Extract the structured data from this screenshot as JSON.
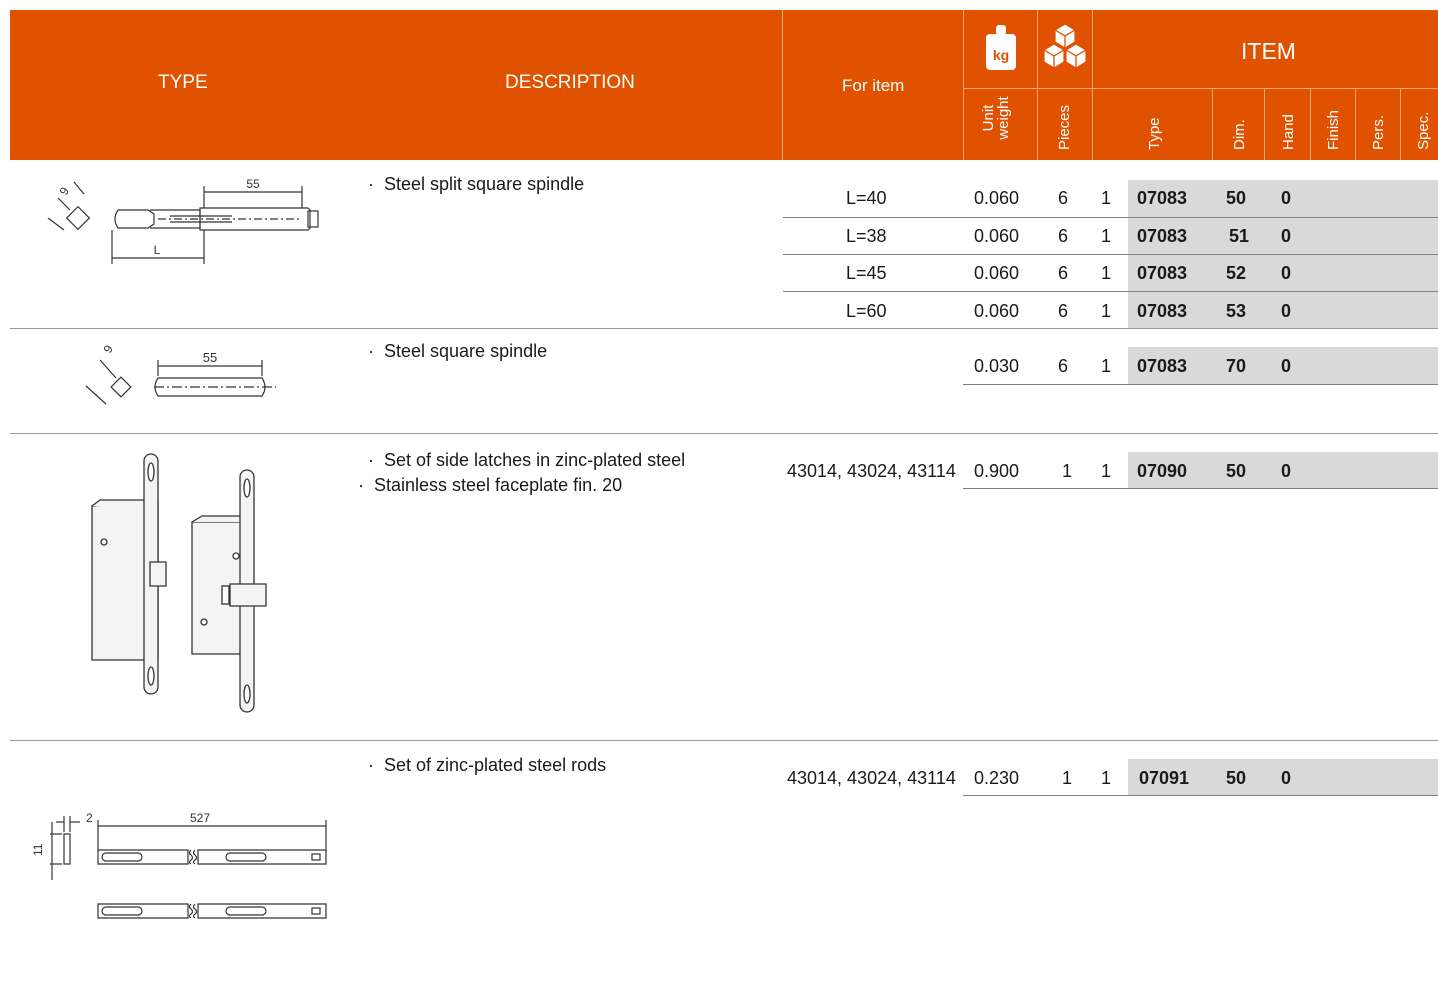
{
  "header": {
    "type_label": "TYPE",
    "description_label": "DESCRIPTION",
    "for_item_label": "For item",
    "weight_icon_text": "kg",
    "item_label": "ITEM",
    "unit_weight_line1": "Unit",
    "unit_weight_line2": "weight",
    "pieces_label": "Pieces",
    "type_col_label": "Type",
    "dim_label": "Dim.",
    "hand_label": "Hand",
    "finish_label": "Finish",
    "pers_label": "Pers.",
    "spec_label": "Spec."
  },
  "sections": [
    {
      "description": [
        "Steel split square spindle"
      ],
      "drawing_labels": {
        "dim_top": "55",
        "dim_bottom": "L",
        "dim_square": "9"
      },
      "rows": [
        {
          "for_item": "L=40",
          "weight": "0.060",
          "pieces": "6",
          "qty": "1",
          "type": "07083",
          "dim": "50",
          "hand": "0"
        },
        {
          "for_item": "L=38",
          "weight": "0.060",
          "pieces": "6",
          "qty": "1",
          "type": "07083",
          "dim": "51",
          "hand": "0"
        },
        {
          "for_item": "L=45",
          "weight": "0.060",
          "pieces": "6",
          "qty": "1",
          "type": "07083",
          "dim": "52",
          "hand": "0"
        },
        {
          "for_item": "L=60",
          "weight": "0.060",
          "pieces": "6",
          "qty": "1",
          "type": "07083",
          "dim": "53",
          "hand": "0"
        }
      ]
    },
    {
      "description": [
        "Steel square spindle"
      ],
      "drawing_labels": {
        "dim_top": "55",
        "dim_square": "9"
      },
      "rows": [
        {
          "for_item": "",
          "weight": "0.030",
          "pieces": "6",
          "qty": "1",
          "type": "07083",
          "dim": "70",
          "hand": "0"
        }
      ]
    },
    {
      "description": [
        "Set of side latches in zinc-plated steel",
        "Stainless steel faceplate fin. 20"
      ],
      "rows": [
        {
          "for_item": "43014, 43024, 43114",
          "weight": "0.900",
          "pieces": "1",
          "qty": "1",
          "type": "07090",
          "dim": "50",
          "hand": "0"
        }
      ]
    },
    {
      "description": [
        "Set of zinc-plated steel rods"
      ],
      "drawing_labels": {
        "dim_thickness": "2",
        "dim_length": "527",
        "dim_height": "11"
      },
      "rows": [
        {
          "for_item": "43014, 43024, 43114",
          "weight": "0.230",
          "pieces": "1",
          "qty": "1",
          "type": "07091",
          "dim": "50",
          "hand": "0"
        }
      ]
    }
  ],
  "colors": {
    "header": "#e05100",
    "item_highlight": "#d9d9d9"
  },
  "icons": [
    "kg-weight-icon",
    "boxes-pieces-icon"
  ]
}
